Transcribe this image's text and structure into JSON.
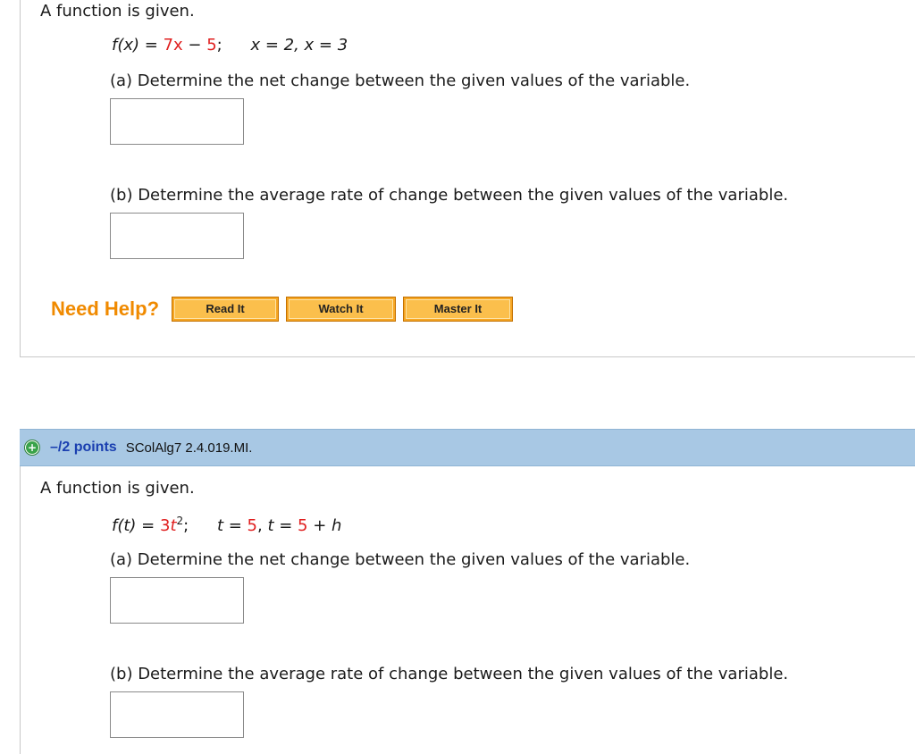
{
  "question1": {
    "intro": "A function is given.",
    "formula": {
      "lhs": "f(x)",
      "eq": " = ",
      "expr_parts": [
        "7x",
        " − ",
        "5",
        ";"
      ],
      "conditions": "x = 2, x = 3"
    },
    "part_a": "(a) Determine the net change between the given values of the variable.",
    "part_b": "(b) Determine the average rate of change between the given values of the variable.",
    "answer_a": "",
    "answer_b": "",
    "help": {
      "label": "Need Help?",
      "read": "Read It",
      "watch": "Watch It",
      "master": "Master It"
    }
  },
  "question2": {
    "header": {
      "points": "–/2 points",
      "id": "SColAlg7 2.4.019.MI."
    },
    "intro": "A function is given.",
    "formula": {
      "lhs": "f(t)",
      "eq": " = ",
      "coef": "3",
      "var": "t",
      "exp": "2",
      "semi": ";",
      "t1_lhs": "t = ",
      "t1_val": "5",
      "sep": ", ",
      "t2_lhs": "t = ",
      "t2_val": "5",
      "t2_rest": " + h"
    },
    "part_a": "(a) Determine the net change between the given values of the variable.",
    "part_b": "(b) Determine the average rate of change between the given values of the variable.",
    "answer_a": "",
    "answer_b": ""
  },
  "colors": {
    "accent_red": "#e02020",
    "help_orange": "#f08a00",
    "header_blue": "#a8c8e4",
    "points_blue": "#1a3fb0"
  }
}
